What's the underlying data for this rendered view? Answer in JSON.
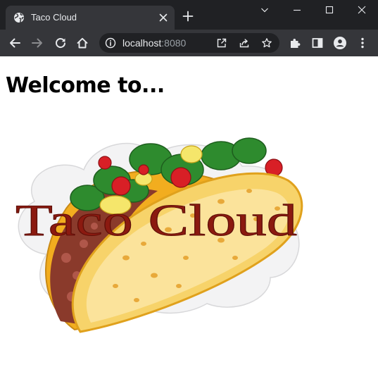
{
  "browser": {
    "tab": {
      "title": "Taco Cloud"
    },
    "address_bar": {
      "host": "localhost",
      "port": ":8080"
    }
  },
  "page": {
    "heading": "Welcome to...",
    "logo": {
      "text": "Taco Cloud"
    }
  },
  "colors": {
    "titlebar_bg": "#202124",
    "toolbar_bg": "#35363a",
    "omnibox_bg": "#202124",
    "logo_text": "#8b1a10",
    "taco_shell": "#f7c535",
    "lettuce": "#2e8b2e",
    "tomato": "#d81f26"
  }
}
